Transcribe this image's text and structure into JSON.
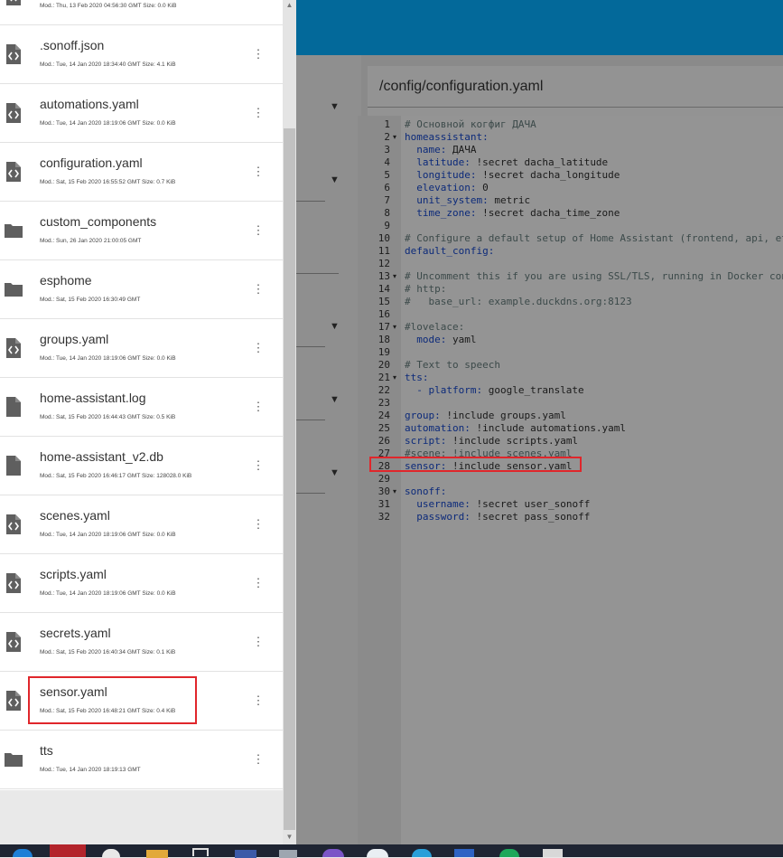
{
  "editor": {
    "path": "/config/configuration.yaml",
    "lines": [
      {
        "n": "1",
        "fold": "",
        "parts": [
          {
            "t": "# Основной когфиг ДАЧА",
            "c": "comment"
          }
        ]
      },
      {
        "n": "2",
        "fold": "▾",
        "parts": [
          {
            "t": "homeassistant:",
            "c": "key"
          }
        ]
      },
      {
        "n": "3",
        "fold": "",
        "parts": [
          {
            "t": "  name: ",
            "c": "key"
          },
          {
            "t": "ДАЧА",
            "c": "val"
          }
        ]
      },
      {
        "n": "4",
        "fold": "",
        "parts": [
          {
            "t": "  latitude: ",
            "c": "key"
          },
          {
            "t": "!secret dacha_latitude",
            "c": "val"
          }
        ]
      },
      {
        "n": "5",
        "fold": "",
        "parts": [
          {
            "t": "  longitude: ",
            "c": "key"
          },
          {
            "t": "!secret dacha_longitude",
            "c": "val"
          }
        ]
      },
      {
        "n": "6",
        "fold": "",
        "parts": [
          {
            "t": "  elevation: ",
            "c": "key"
          },
          {
            "t": "0",
            "c": "val"
          }
        ]
      },
      {
        "n": "7",
        "fold": "",
        "parts": [
          {
            "t": "  unit_system: ",
            "c": "key"
          },
          {
            "t": "metric",
            "c": "val"
          }
        ]
      },
      {
        "n": "8",
        "fold": "",
        "parts": [
          {
            "t": "  time_zone: ",
            "c": "key"
          },
          {
            "t": "!secret dacha_time_zone",
            "c": "val"
          }
        ]
      },
      {
        "n": "9",
        "fold": "",
        "parts": []
      },
      {
        "n": "10",
        "fold": "",
        "parts": [
          {
            "t": "# Configure a default setup of Home Assistant (frontend, api, et",
            "c": "comment"
          }
        ]
      },
      {
        "n": "11",
        "fold": "",
        "parts": [
          {
            "t": "default_config:",
            "c": "key"
          }
        ]
      },
      {
        "n": "12",
        "fold": "",
        "parts": []
      },
      {
        "n": "13",
        "fold": "▾",
        "parts": [
          {
            "t": "# Uncomment this if you are using SSL/TLS, running in Docker con",
            "c": "comment"
          }
        ]
      },
      {
        "n": "14",
        "fold": "",
        "parts": [
          {
            "t": "# http:",
            "c": "comment"
          }
        ]
      },
      {
        "n": "15",
        "fold": "",
        "parts": [
          {
            "t": "#   base_url: example.duckdns.org:8123",
            "c": "comment"
          }
        ]
      },
      {
        "n": "16",
        "fold": "",
        "parts": []
      },
      {
        "n": "17",
        "fold": "▾",
        "parts": [
          {
            "t": "#lovelace:",
            "c": "comment"
          }
        ]
      },
      {
        "n": "18",
        "fold": "",
        "parts": [
          {
            "t": "  mode: ",
            "c": "key"
          },
          {
            "t": "yaml",
            "c": "val"
          }
        ]
      },
      {
        "n": "19",
        "fold": "",
        "parts": []
      },
      {
        "n": "20",
        "fold": "",
        "parts": [
          {
            "t": "# Text to speech",
            "c": "comment"
          }
        ]
      },
      {
        "n": "21",
        "fold": "▾",
        "parts": [
          {
            "t": "tts:",
            "c": "key"
          }
        ]
      },
      {
        "n": "22",
        "fold": "",
        "parts": [
          {
            "t": "  - platform: ",
            "c": "key"
          },
          {
            "t": "google_translate",
            "c": "val"
          }
        ]
      },
      {
        "n": "23",
        "fold": "",
        "parts": []
      },
      {
        "n": "24",
        "fold": "",
        "parts": [
          {
            "t": "group: ",
            "c": "key"
          },
          {
            "t": "!include groups.yaml",
            "c": "val"
          }
        ]
      },
      {
        "n": "25",
        "fold": "",
        "parts": [
          {
            "t": "automation: ",
            "c": "key"
          },
          {
            "t": "!include automations.yaml",
            "c": "val"
          }
        ]
      },
      {
        "n": "26",
        "fold": "",
        "parts": [
          {
            "t": "script: ",
            "c": "key"
          },
          {
            "t": "!include scripts.yaml",
            "c": "val"
          }
        ]
      },
      {
        "n": "27",
        "fold": "",
        "parts": [
          {
            "t": "#scene: !include scenes.yaml",
            "c": "comment"
          }
        ]
      },
      {
        "n": "28",
        "fold": "",
        "parts": [
          {
            "t": "sensor: ",
            "c": "key"
          },
          {
            "t": "!include sensor.yaml",
            "c": "val"
          }
        ]
      },
      {
        "n": "29",
        "fold": "",
        "parts": []
      },
      {
        "n": "30",
        "fold": "▾",
        "parts": [
          {
            "t": "sonoff:",
            "c": "key"
          }
        ]
      },
      {
        "n": "31",
        "fold": "",
        "parts": [
          {
            "t": "  username: ",
            "c": "key"
          },
          {
            "t": "!secret user_sonoff",
            "c": "val"
          }
        ]
      },
      {
        "n": "32",
        "fold": "",
        "parts": [
          {
            "t": "  password: ",
            "c": "key"
          },
          {
            "t": "!secret pass_sonoff",
            "c": "val"
          }
        ]
      }
    ]
  },
  "files": [
    {
      "name": "",
      "meta": "Mod.: Thu, 13 Feb 2020 04:56:30 GMT  Size: 0.0 KiB",
      "icon": "file-code-icon"
    },
    {
      "name": ".sonoff.json",
      "meta": "Mod.: Tue, 14 Jan 2020 18:34:40 GMT  Size: 4.1 KiB",
      "icon": "file-code-icon"
    },
    {
      "name": "automations.yaml",
      "meta": "Mod.: Tue, 14 Jan 2020 18:19:06 GMT  Size: 0.0 KiB",
      "icon": "file-code-icon"
    },
    {
      "name": "configuration.yaml",
      "meta": "Mod.: Sat, 15 Feb 2020 16:55:52 GMT  Size: 0.7 KiB",
      "icon": "file-code-icon"
    },
    {
      "name": "custom_components",
      "meta": "Mod.: Sun, 26 Jan 2020 21:00:05 GMT",
      "icon": "folder-icon"
    },
    {
      "name": "esphome",
      "meta": "Mod.: Sat, 15 Feb 2020 16:30:49 GMT",
      "icon": "folder-icon"
    },
    {
      "name": "groups.yaml",
      "meta": "Mod.: Tue, 14 Jan 2020 18:19:06 GMT  Size: 0.0 KiB",
      "icon": "file-code-icon"
    },
    {
      "name": "home-assistant.log",
      "meta": "Mod.: Sat, 15 Feb 2020 16:44:43 GMT  Size: 0.5 KiB",
      "icon": "file-icon"
    },
    {
      "name": "home-assistant_v2.db",
      "meta": "Mod.: Sat, 15 Feb 2020 16:46:17 GMT  Size: 128028.0 KiB",
      "icon": "file-icon"
    },
    {
      "name": "scenes.yaml",
      "meta": "Mod.: Tue, 14 Jan 2020 18:19:06 GMT  Size: 0.0 KiB",
      "icon": "file-code-icon"
    },
    {
      "name": "scripts.yaml",
      "meta": "Mod.: Tue, 14 Jan 2020 18:19:06 GMT  Size: 0.0 KiB",
      "icon": "file-code-icon"
    },
    {
      "name": "secrets.yaml",
      "meta": "Mod.: Sat, 15 Feb 2020 16:40:34 GMT  Size: 0.1 KiB",
      "icon": "file-code-icon"
    },
    {
      "name": "sensor.yaml",
      "meta": "Mod.: Sat, 15 Feb 2020 16:48:21 GMT  Size: 0.4 KiB",
      "icon": "file-code-icon"
    },
    {
      "name": "tts",
      "meta": "Mod.: Tue, 14 Jan 2020 18:19:13 GMT",
      "icon": "folder-icon"
    }
  ],
  "colors": {
    "topbar": "#03699a",
    "highlight": "#e0262b"
  }
}
